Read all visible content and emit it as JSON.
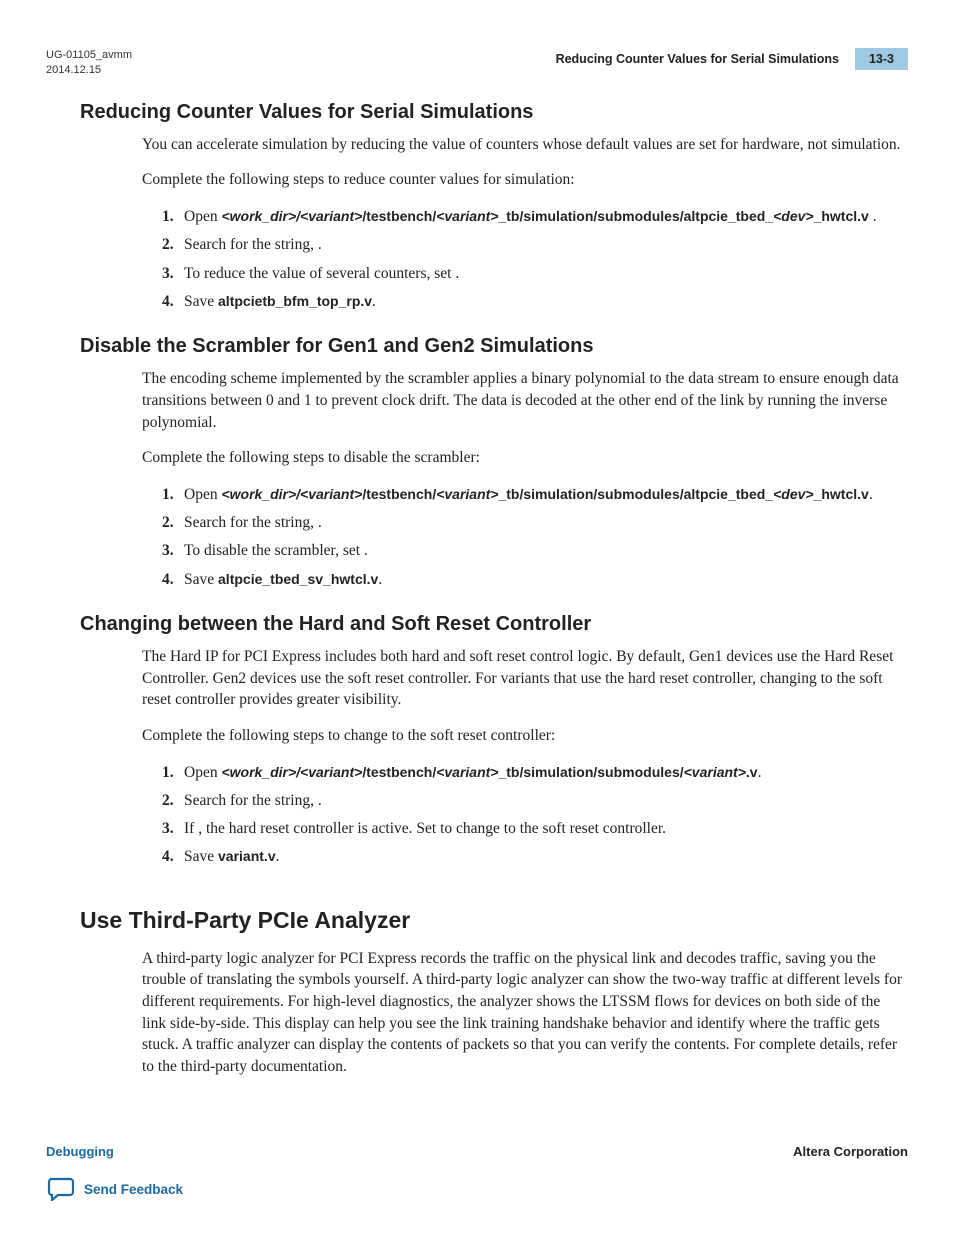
{
  "header": {
    "doc_id": "UG-01105_avmm",
    "date": "2014.12.15",
    "title": "Reducing Counter Values for Serial Simulations",
    "page": "13-3"
  },
  "sections": {
    "s1": {
      "heading": "Reducing Counter Values for Serial Simulations",
      "p1": "You can accelerate simulation by reducing the value of counters whose default values are set for hardware, not simulation.",
      "p2": "Complete the following steps to reduce counter values for simulation:",
      "steps": {
        "i1a": "Open ",
        "i1b": "<work_dir>/<variant>",
        "i1c": "/testbench/",
        "i1d": "<variant>",
        "i1e": "_tb/simulation/submodules/altpcie_tbed_",
        "i1f": "<dev>",
        "i1g": "_hwtcl.v ",
        "i1h": ".",
        "i2": "Search for the string,             .",
        "i3": "To reduce the value of several counters, set                           .",
        "i4a": "Save ",
        "i4b": "altpcietb_bfm_top_rp.v",
        "i4c": "."
      }
    },
    "s2": {
      "heading": "Disable the Scrambler for Gen1 and Gen2 Simulations",
      "p1": "The encoding scheme implemented by the scrambler applies a binary polynomial to the data stream to ensure enough data transitions between 0 and 1 to prevent clock drift. The data is decoded at the other end of the link by running the inverse polynomial.",
      "p2": "Complete the following steps to disable the scrambler:",
      "steps": {
        "i1a": "Open ",
        "i1b": "<work_dir>/<variant>",
        "i1c": "/testbench/",
        "i1d": "<variant>",
        "i1e": "_tb/simulation/submodules/altpcie_tbed_",
        "i1f": "<dev>",
        "i1g": "_hwtcl.v",
        "i1h": ".",
        "i2": "Search for the string,             .",
        "i3": "To disable the scrambler, set                           .",
        "i4a": "Save ",
        "i4b": "altpcie_tbed_sv_hwtcl.v",
        "i4c": "."
      }
    },
    "s3": {
      "heading": "Changing between the Hard and Soft Reset Controller",
      "p1": "The Hard IP for PCI Express includes both hard and soft reset control logic. By default, Gen1 devices use the Hard Reset Controller. Gen2  devices use the soft reset controller. For variants that use the hard reset controller, changing to the soft reset controller provides greater visibility.",
      "p2": "Complete the following steps to change to the soft reset controller:",
      "steps": {
        "i1a": "Open ",
        "i1b": "<work_dir>/<variant>",
        "i1c": "/testbench/",
        "i1d": "<variant>",
        "i1e": "_tb/simulation/submodules/",
        "i1f": "<variant>",
        "i1g": ".v",
        "i1h": ".",
        "i2": "Search for the string,                                           .",
        "i3": "If                                                     , the hard reset controller is active. Set                                                                                         to change to the soft reset controller.",
        "i4a": "Save ",
        "i4b": "variant.v",
        "i4c": "."
      }
    },
    "s4": {
      "heading": "Use Third-Party PCIe Analyzer",
      "p1": "A third-party logic analyzer for PCI Express records the traffic on the physical link and decodes traffic, saving you the trouble of translating the symbols yourself. A third‑party logic analyzer can show the two‑way traffic at different levels for different requirements. For high-level diagnostics, the analyzer shows the LTSSM flows for devices on both side of the link side-by-side. This display can help you see the link training handshake behavior and identify where the traffic gets stuck. A traffic analyzer can display the contents of packets so that you can verify the contents. For complete details, refer to the third-party documentation."
    }
  },
  "footer": {
    "left_link": "Debugging",
    "right": "Altera Corporation",
    "feedback": "Send Feedback"
  }
}
